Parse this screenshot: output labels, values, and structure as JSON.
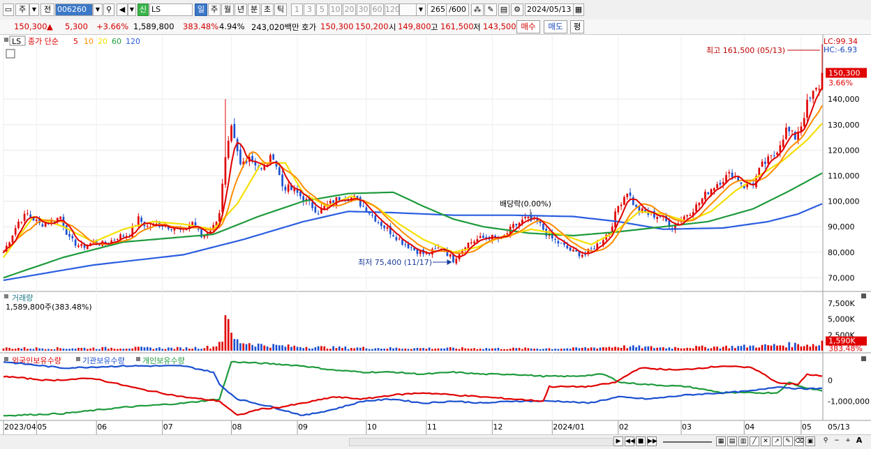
{
  "toolbar": {
    "market_type": "주",
    "category": "전",
    "code": "006260",
    "credit_badge": "신",
    "name": "LS",
    "periods": [
      "일",
      "주",
      "월",
      "년",
      "분",
      "초",
      "틱"
    ],
    "selected_period": "일",
    "multipliers": [
      "1",
      "3",
      "5",
      "10",
      "20",
      "30",
      "60",
      "120"
    ],
    "count": "265",
    "max_count": "/600",
    "date": "2024/05/13"
  },
  "quote": {
    "price": "150,300",
    "change": "5,300",
    "change_pct": "+3.66%",
    "volume": "1,589,800",
    "volume_ratio": "383.48%",
    "turnover": "4.94%",
    "amount": "243,020백만",
    "hoga_label": "호가",
    "ask": "150,300",
    "bid": "150,200",
    "open_label": "시",
    "open": "149,800",
    "high_label": "고",
    "high": "161,500",
    "low_label": "저",
    "low": "143,500",
    "buy_button": "매수",
    "sell_button": "매도",
    "eval_button": "평"
  },
  "colors": {
    "up": "#e00000",
    "down": "#1a4fd0",
    "ma5": "#e00000",
    "ma10": "#ff8c00",
    "ma20": "#f5e000",
    "ma60": "#1e9a3c",
    "ma120": "#2a5de0"
  },
  "chart_data": [
    {
      "type": "line",
      "title": "LS",
      "legend": [
        "종가 단순",
        "5",
        "10",
        "20",
        "60",
        "120"
      ],
      "legend_prefix": "LS",
      "ylim": [
        66000,
        163000
      ],
      "y_ticks": [
        "70,000",
        "80,000",
        "90,000",
        "100,000",
        "110,000",
        "120,000",
        "130,000",
        "140,000"
      ],
      "y_tick_values": [
        70000,
        80000,
        90000,
        100000,
        110000,
        120000,
        130000,
        140000
      ],
      "x_labels": [
        "2023/04",
        "05",
        "06",
        "07",
        "08",
        "09",
        "10",
        "11",
        "12",
        "2024/01",
        "02",
        "03",
        "04",
        "05",
        "05/13"
      ],
      "x_label_index": [
        0,
        11,
        31,
        53,
        76,
        98,
        121,
        141,
        163,
        183,
        205,
        226,
        247,
        266,
        270
      ],
      "n_days": 274,
      "lc": "LC:99.34",
      "hc": "HC:-6.93",
      "current_price": "150,300",
      "current_pct": "3.66%",
      "high_annotation": "최고 161,500 (05/13)",
      "low_annotation": "최저 75,400 (11/17)",
      "dividend_annotation": "배당락(0.00%)",
      "price_keypoints": [
        [
          0,
          80000
        ],
        [
          5,
          92000
        ],
        [
          8,
          95000
        ],
        [
          12,
          91000
        ],
        [
          16,
          92000
        ],
        [
          19,
          94000
        ],
        [
          22,
          85000
        ],
        [
          26,
          82000
        ],
        [
          30,
          84000
        ],
        [
          34,
          83000
        ],
        [
          38,
          86000
        ],
        [
          42,
          87000
        ],
        [
          45,
          93000
        ],
        [
          48,
          90000
        ],
        [
          52,
          91000
        ],
        [
          56,
          90000
        ],
        [
          60,
          88000
        ],
        [
          63,
          92000
        ],
        [
          66,
          86000
        ],
        [
          70,
          90000
        ],
        [
          72,
          96000
        ],
        [
          74,
          116000
        ],
        [
          76,
          128000
        ],
        [
          79,
          114000
        ],
        [
          82,
          118000
        ],
        [
          86,
          112000
        ],
        [
          90,
          118000
        ],
        [
          93,
          106000
        ],
        [
          97,
          104000
        ],
        [
          101,
          100000
        ],
        [
          105,
          96000
        ],
        [
          109,
          99000
        ],
        [
          113,
          102000
        ],
        [
          117,
          101000
        ],
        [
          121,
          97000
        ],
        [
          125,
          92000
        ],
        [
          129,
          88000
        ],
        [
          133,
          84000
        ],
        [
          137,
          81000
        ],
        [
          141,
          79000
        ],
        [
          146,
          82000
        ],
        [
          150,
          77000
        ],
        [
          154,
          83000
        ],
        [
          158,
          85000
        ],
        [
          162,
          86000
        ],
        [
          166,
          85000
        ],
        [
          170,
          90000
        ],
        [
          174,
          93000
        ],
        [
          178,
          92000
        ],
        [
          182,
          86000
        ],
        [
          186,
          83000
        ],
        [
          190,
          80000
        ],
        [
          194,
          79000
        ],
        [
          198,
          83000
        ],
        [
          202,
          88000
        ],
        [
          205,
          98000
        ],
        [
          208,
          104000
        ],
        [
          211,
          97000
        ],
        [
          215,
          95000
        ],
        [
          219,
          94000
        ],
        [
          223,
          90000
        ],
        [
          227,
          94000
        ],
        [
          231,
          98000
        ],
        [
          235,
          104000
        ],
        [
          239,
          108000
        ],
        [
          243,
          111000
        ],
        [
          247,
          106000
        ],
        [
          250,
          107000
        ],
        [
          253,
          114000
        ],
        [
          257,
          118000
        ],
        [
          261,
          128000
        ],
        [
          264,
          125000
        ],
        [
          266,
          130000
        ],
        [
          268,
          138000
        ],
        [
          270,
          142000
        ],
        [
          272,
          145000
        ],
        [
          273,
          150300
        ]
      ],
      "ma20_keypoints": [
        [
          0,
          78000
        ],
        [
          10,
          94000
        ],
        [
          20,
          90000
        ],
        [
          30,
          84000
        ],
        [
          40,
          89000
        ],
        [
          50,
          92000
        ],
        [
          60,
          91000
        ],
        [
          70,
          89000
        ],
        [
          78,
          99000
        ],
        [
          86,
          115000
        ],
        [
          94,
          115000
        ],
        [
          100,
          103000
        ],
        [
          108,
          98000
        ],
        [
          116,
          102000
        ],
        [
          124,
          98000
        ],
        [
          132,
          91000
        ],
        [
          140,
          85000
        ],
        [
          150,
          80000
        ],
        [
          158,
          82000
        ],
        [
          166,
          86000
        ],
        [
          176,
          89000
        ],
        [
          186,
          87000
        ],
        [
          196,
          83000
        ],
        [
          204,
          88000
        ],
        [
          212,
          96000
        ],
        [
          220,
          95000
        ],
        [
          228,
          92000
        ],
        [
          236,
          96000
        ],
        [
          244,
          104000
        ],
        [
          252,
          110000
        ],
        [
          260,
          116000
        ],
        [
          268,
          124000
        ],
        [
          273,
          130500
        ]
      ],
      "ma60_keypoints": [
        [
          0,
          70000
        ],
        [
          20,
          78000
        ],
        [
          40,
          84000
        ],
        [
          60,
          86000
        ],
        [
          70,
          87000
        ],
        [
          85,
          94000
        ],
        [
          100,
          100000
        ],
        [
          115,
          103000
        ],
        [
          130,
          103500
        ],
        [
          140,
          98000
        ],
        [
          150,
          93000
        ],
        [
          160,
          90000
        ],
        [
          175,
          87500
        ],
        [
          190,
          86500
        ],
        [
          205,
          88000
        ],
        [
          220,
          90000
        ],
        [
          235,
          92000
        ],
        [
          250,
          97000
        ],
        [
          262,
          104000
        ],
        [
          273,
          111000
        ]
      ],
      "ma120_keypoints": [
        [
          0,
          69000
        ],
        [
          30,
          75000
        ],
        [
          60,
          79000
        ],
        [
          80,
          85000
        ],
        [
          100,
          92000
        ],
        [
          115,
          96000
        ],
        [
          130,
          95500
        ],
        [
          150,
          94500
        ],
        [
          170,
          94500
        ],
        [
          190,
          94000
        ],
        [
          205,
          92000
        ],
        [
          220,
          89000
        ],
        [
          240,
          89500
        ],
        [
          255,
          92000
        ],
        [
          265,
          95000
        ],
        [
          273,
          99000
        ]
      ],
      "bollinger": false
    },
    {
      "type": "bar",
      "title": "거래량",
      "summary": "1,589,800주(383.48%)",
      "y_ticks": [
        "7,500K",
        "5,000K",
        "2,500K"
      ],
      "y_tick_values": [
        7500,
        5000,
        2500
      ],
      "ylim": [
        0,
        8600
      ],
      "current_label": "1,590K",
      "current_pct": "383.48%",
      "volume_keypoints": [
        [
          0,
          420
        ],
        [
          20,
          380
        ],
        [
          40,
          450
        ],
        [
          60,
          400
        ],
        [
          70,
          600
        ],
        [
          73,
          1800
        ],
        [
          74,
          7800
        ],
        [
          75,
          3600
        ],
        [
          76,
          2400
        ],
        [
          78,
          1500
        ],
        [
          82,
          1200
        ],
        [
          86,
          900
        ],
        [
          95,
          700
        ],
        [
          110,
          500
        ],
        [
          130,
          400
        ],
        [
          150,
          380
        ],
        [
          170,
          350
        ],
        [
          190,
          360
        ],
        [
          205,
          650
        ],
        [
          220,
          500
        ],
        [
          240,
          600
        ],
        [
          255,
          800
        ],
        [
          265,
          1000
        ],
        [
          272,
          900
        ],
        [
          273,
          1590
        ]
      ],
      "volume_unit": "K"
    },
    {
      "type": "line",
      "title": "보유수량",
      "legend": [
        "외국인보유수량",
        "기관보유수량",
        "개인보유수량"
      ],
      "y_ticks": [
        "0",
        "-1,000,000"
      ],
      "y_tick_values": [
        0,
        -1000000
      ],
      "ylim": [
        -1900000,
        1100000
      ],
      "foreign_keypoints": [
        [
          0,
          200000
        ],
        [
          15,
          0
        ],
        [
          30,
          100000
        ],
        [
          45,
          -400000
        ],
        [
          60,
          -800000
        ],
        [
          72,
          -1000000
        ],
        [
          78,
          -1700000
        ],
        [
          85,
          -1400000
        ],
        [
          92,
          -1300000
        ],
        [
          100,
          -1100000
        ],
        [
          110,
          -800000
        ],
        [
          120,
          -900000
        ],
        [
          130,
          -700000
        ],
        [
          140,
          -600000
        ],
        [
          150,
          -700000
        ],
        [
          160,
          -800000
        ],
        [
          170,
          -900000
        ],
        [
          180,
          -1000000
        ],
        [
          182,
          -300000
        ],
        [
          195,
          -300000
        ],
        [
          204,
          -100000
        ],
        [
          212,
          600000
        ],
        [
          225,
          500000
        ],
        [
          240,
          700000
        ],
        [
          250,
          600000
        ],
        [
          258,
          -100000
        ],
        [
          265,
          -200000
        ],
        [
          268,
          300000
        ],
        [
          273,
          200000
        ]
      ],
      "institution_keypoints": [
        [
          0,
          900000
        ],
        [
          20,
          600000
        ],
        [
          40,
          700000
        ],
        [
          60,
          700000
        ],
        [
          70,
          400000
        ],
        [
          72,
          -200000
        ],
        [
          78,
          -900000
        ],
        [
          90,
          -1300000
        ],
        [
          100,
          -1700000
        ],
        [
          110,
          -1400000
        ],
        [
          120,
          -1000000
        ],
        [
          130,
          -900000
        ],
        [
          140,
          -1100000
        ],
        [
          150,
          -1000000
        ],
        [
          160,
          -1100000
        ],
        [
          170,
          -1000000
        ],
        [
          185,
          -1000000
        ],
        [
          195,
          -1100000
        ],
        [
          205,
          -800000
        ],
        [
          215,
          -900000
        ],
        [
          228,
          -700000
        ],
        [
          240,
          -600000
        ],
        [
          250,
          -500000
        ],
        [
          258,
          -300000
        ],
        [
          265,
          -400000
        ],
        [
          273,
          -400000
        ]
      ],
      "individual_keypoints": [
        [
          0,
          -1700000
        ],
        [
          20,
          -1600000
        ],
        [
          40,
          -1300000
        ],
        [
          60,
          -1100000
        ],
        [
          72,
          -900000
        ],
        [
          76,
          900000
        ],
        [
          90,
          800000
        ],
        [
          100,
          700000
        ],
        [
          110,
          500000
        ],
        [
          120,
          400000
        ],
        [
          130,
          400000
        ],
        [
          140,
          300000
        ],
        [
          150,
          400000
        ],
        [
          160,
          300000
        ],
        [
          170,
          300000
        ],
        [
          180,
          200000
        ],
        [
          190,
          200000
        ],
        [
          200,
          300000
        ],
        [
          206,
          -100000
        ],
        [
          215,
          -200000
        ],
        [
          228,
          -300000
        ],
        [
          240,
          -600000
        ],
        [
          250,
          -600000
        ],
        [
          258,
          -600000
        ],
        [
          262,
          -100000
        ],
        [
          266,
          -300000
        ],
        [
          273,
          -500000
        ]
      ]
    }
  ],
  "statusbar": {
    "zoom_minus": "−",
    "zoom_plus": "+",
    "font_a": "A"
  }
}
